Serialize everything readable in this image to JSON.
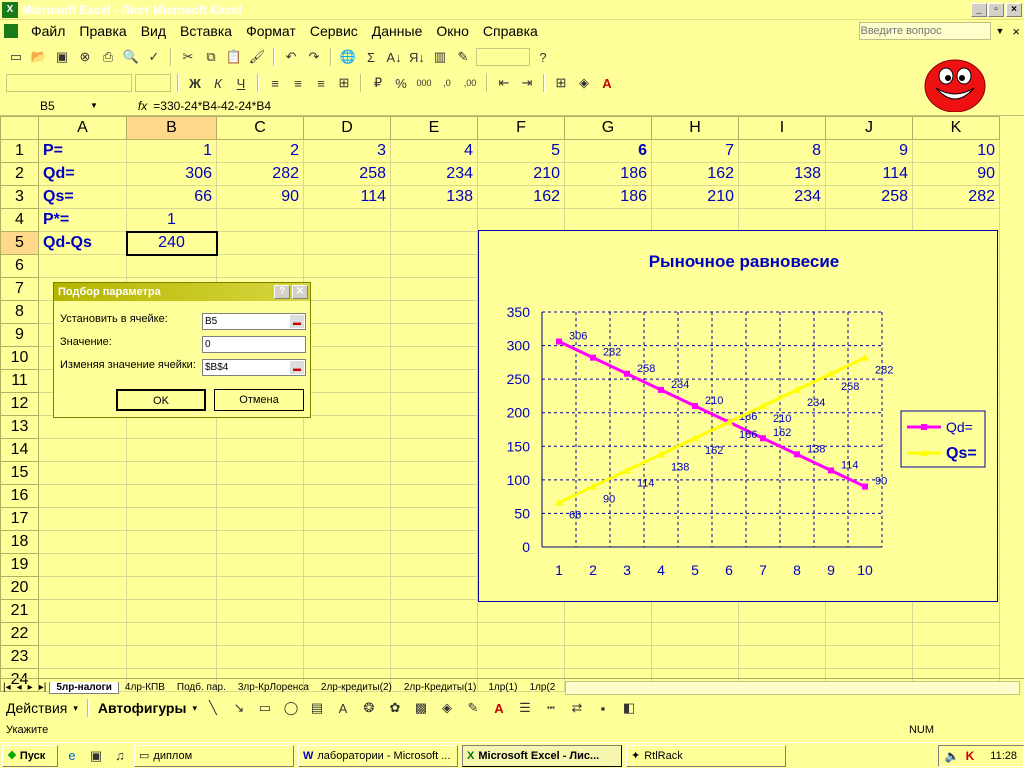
{
  "window": {
    "title": "Microsoft Excel - Лист Microsoft Excel"
  },
  "menu": [
    "Файл",
    "Правка",
    "Вид",
    "Вставка",
    "Формат",
    "Сервис",
    "Данные",
    "Окно",
    "Справка"
  ],
  "help_box": {
    "placeholder": "Введите вопрос"
  },
  "formula_bar": {
    "cell_ref": "B5",
    "fx": "fx",
    "formula": "=330-24*B4-42-24*B4"
  },
  "sheet": {
    "columns": [
      "A",
      "B",
      "C",
      "D",
      "E",
      "F",
      "G",
      "H",
      "I",
      "J",
      "K"
    ],
    "rows": [
      "1",
      "2",
      "3",
      "4",
      "5",
      "6",
      "7",
      "8",
      "9",
      "10",
      "11",
      "12",
      "13",
      "14",
      "15",
      "16",
      "17",
      "18",
      "19",
      "20",
      "21",
      "22",
      "23",
      "24"
    ],
    "r1": {
      "label": "P=",
      "values": [
        "1",
        "2",
        "3",
        "4",
        "5",
        "6",
        "7",
        "8",
        "9",
        "10"
      ]
    },
    "r2": {
      "label": "Qd=",
      "values": [
        "306",
        "282",
        "258",
        "234",
        "210",
        "186",
        "162",
        "138",
        "114",
        "90"
      ]
    },
    "r3": {
      "label": "Qs=",
      "values": [
        "66",
        "90",
        "114",
        "138",
        "162",
        "186",
        "210",
        "234",
        "258",
        "282"
      ]
    },
    "r4": {
      "label": "P*=",
      "value": "1"
    },
    "r5": {
      "label": "Qd-Qs",
      "value": "240"
    }
  },
  "dialog": {
    "title": "Подбор параметра",
    "set_cell_label": "Установить в ячейке:",
    "set_cell_value": "B5",
    "value_label": "Значение:",
    "value_value": "0",
    "changing_label": "Изменяя значение ячейки:",
    "changing_value": "$B$4",
    "ok": "OK",
    "cancel": "Отмена",
    "help": "?",
    "close": "✕"
  },
  "chart_data": {
    "type": "line",
    "title": "Рыночное равновесие",
    "x": [
      1,
      2,
      3,
      4,
      5,
      6,
      7,
      8,
      9,
      10
    ],
    "series": [
      {
        "name": "Qd=",
        "values": [
          306,
          282,
          258,
          234,
          210,
          186,
          162,
          138,
          114,
          90
        ],
        "color": "#ff00ff"
      },
      {
        "name": "Qs=",
        "values": [
          66,
          90,
          114,
          138,
          162,
          186,
          210,
          234,
          258,
          282
        ],
        "color": "#ffff00"
      }
    ],
    "ylim": [
      0,
      350
    ],
    "yticks": [
      "0",
      "50",
      "100",
      "150",
      "200",
      "250",
      "300",
      "350"
    ],
    "xticks": [
      "1",
      "2",
      "3",
      "4",
      "5",
      "6",
      "7",
      "8",
      "9",
      "10"
    ],
    "grid": true,
    "legend": "right"
  },
  "tabs": [
    "5лр-налоги",
    "4лр-КПВ",
    "Подб. пар.",
    "3лр-КрЛоренса",
    "2лр-кредиты(2)",
    "2лр-Кредиты(1)",
    "1лр(1)",
    "1лр(2"
  ],
  "drawbar": {
    "actions": "Действия",
    "autoshapes": "Автофигуры"
  },
  "status": {
    "left": "Укажите",
    "num": "NUM"
  },
  "taskbar": {
    "start": "Пуск",
    "items": [
      "диплом",
      "лаборатории - Microsoft ...",
      "Microsoft Excel - Лис...",
      "RtlRack"
    ],
    "clock": "11:28"
  },
  "colors": {
    "background": "#ffff99",
    "text_blue": "#0000c0",
    "qd": "#ff00ff",
    "qs": "#ffff00"
  }
}
